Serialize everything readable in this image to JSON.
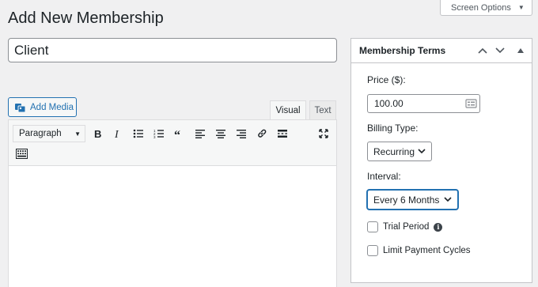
{
  "page": {
    "title": "Add New Membership",
    "screen_options_label": "Screen Options"
  },
  "post_title": {
    "value": "Client"
  },
  "editor": {
    "add_media_label": "Add Media",
    "tabs": [
      {
        "label": "Visual",
        "active": true
      },
      {
        "label": "Text",
        "active": false
      }
    ],
    "format_select_value": "Paragraph",
    "toolbar_icons": [
      "bold-icon",
      "italic-icon",
      "bulleted-list-icon",
      "numbered-list-icon",
      "blockquote-icon",
      "align-left-icon",
      "align-center-icon",
      "align-right-icon",
      "link-icon",
      "read-more-icon",
      "fullscreen-icon",
      "toolbar-toggle-icon"
    ]
  },
  "membership_terms": {
    "title": "Membership Terms",
    "price_label": "Price ($):",
    "price_value": "100.00",
    "billing_type_label": "Billing Type:",
    "billing_type_value": "Recurring",
    "interval_label": "Interval:",
    "interval_value": "Every 6 Months",
    "trial_period_label": "Trial Period",
    "trial_period_checked": false,
    "limit_payment_cycles_label": "Limit Payment Cycles",
    "limit_payment_cycles_checked": false
  },
  "colors": {
    "accent": "#2271b1",
    "background": "#f0f0f1",
    "text": "#1d2327"
  }
}
